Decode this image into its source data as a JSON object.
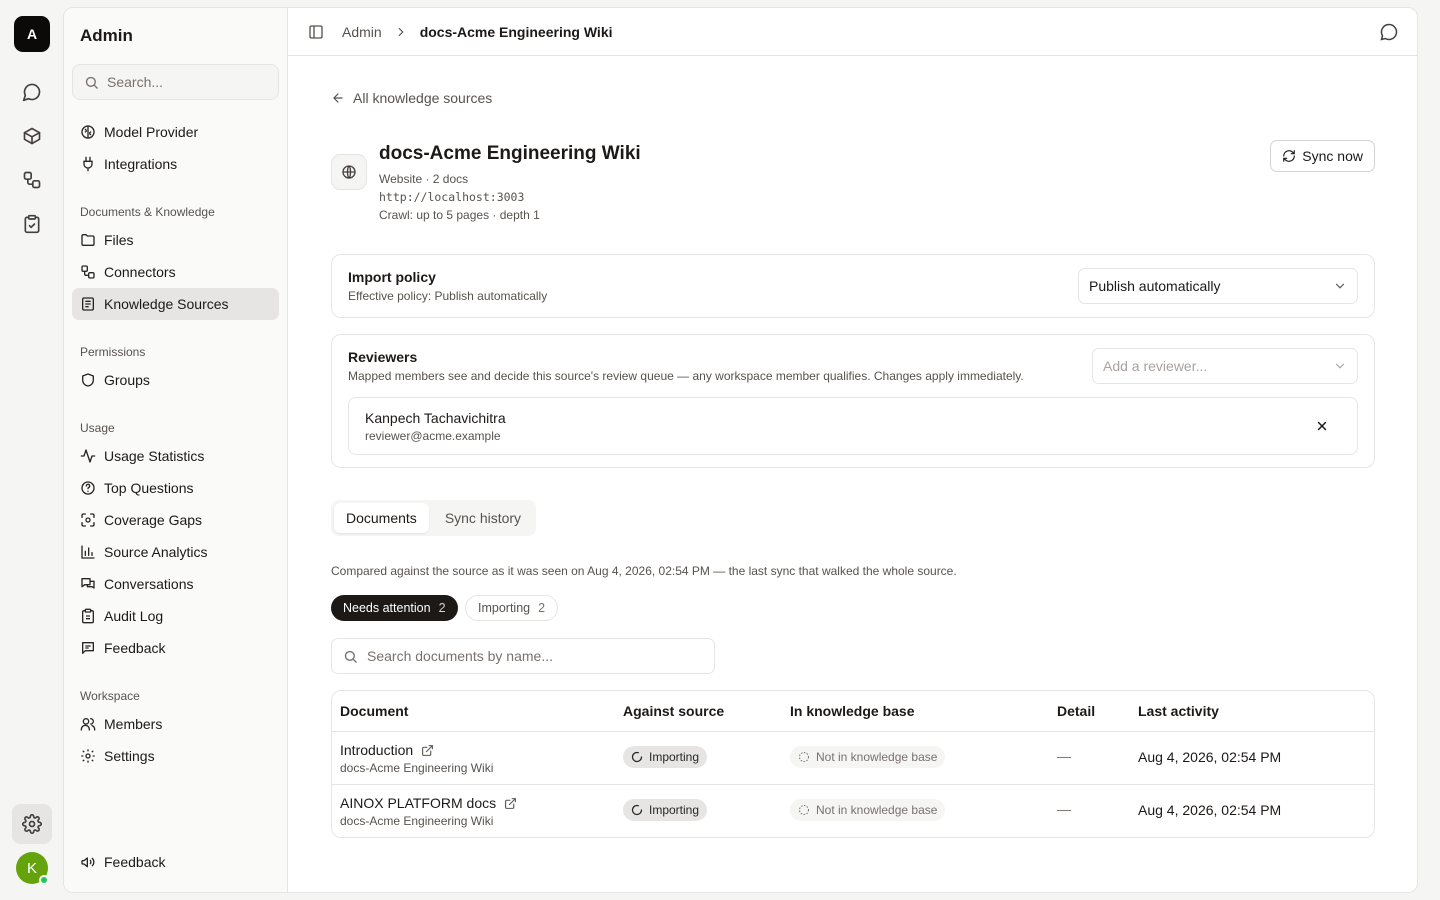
{
  "rail": {
    "logo_letter": "A",
    "avatar_letter": "K",
    "items": [
      "chat-icon",
      "box-icon",
      "workflow-icon",
      "clipboard-check-icon"
    ],
    "active_item": "settings-icon"
  },
  "sidebar": {
    "title": "Admin",
    "search_placeholder": "Search...",
    "top_items": [
      {
        "label": "Model Provider",
        "icon": "brain-icon"
      },
      {
        "label": "Integrations",
        "icon": "plug-icon"
      }
    ],
    "sections": [
      {
        "title": "Documents & Knowledge",
        "items": [
          {
            "label": "Files",
            "icon": "folder-icon"
          },
          {
            "label": "Connectors",
            "icon": "connector-icon"
          },
          {
            "label": "Knowledge Sources",
            "icon": "book-icon",
            "active": true
          }
        ]
      },
      {
        "title": "Permissions",
        "items": [
          {
            "label": "Groups",
            "icon": "shield-icon"
          }
        ]
      },
      {
        "title": "Usage",
        "items": [
          {
            "label": "Usage Statistics",
            "icon": "activity-icon"
          },
          {
            "label": "Top Questions",
            "icon": "help-circle-icon"
          },
          {
            "label": "Coverage Gaps",
            "icon": "scan-icon"
          },
          {
            "label": "Source Analytics",
            "icon": "bar-chart-icon"
          },
          {
            "label": "Conversations",
            "icon": "messages-icon"
          },
          {
            "label": "Audit Log",
            "icon": "clipboard-icon"
          },
          {
            "label": "Feedback",
            "icon": "message-square-icon"
          }
        ]
      },
      {
        "title": "Workspace",
        "items": [
          {
            "label": "Members",
            "icon": "users-icon"
          },
          {
            "label": "Settings",
            "icon": "gear-icon"
          }
        ]
      }
    ],
    "footer_item": {
      "label": "Feedback",
      "icon": "megaphone-icon"
    }
  },
  "header": {
    "breadcrumb_root": "Admin",
    "breadcrumb_current": "docs-Acme Engineering Wiki"
  },
  "source": {
    "back_label": "All knowledge sources",
    "title": "docs-Acme Engineering Wiki",
    "type_line": "Website · 2 docs",
    "url": "http://localhost:3003",
    "crawl_line": "Crawl: up to 5 pages · depth 1",
    "sync_label": "Sync now"
  },
  "import_policy": {
    "title": "Import policy",
    "subtitle": "Effective policy: Publish automatically",
    "selected": "Publish automatically"
  },
  "reviewers": {
    "title": "Reviewers",
    "subtitle": "Mapped members see and decide this source's review queue — any workspace member qualifies. Changes apply immediately.",
    "add_placeholder": "Add a reviewer...",
    "list": [
      {
        "name": "Kanpech Tachavichitra",
        "email": "reviewer@acme.example"
      }
    ]
  },
  "tabs": [
    "Documents",
    "Sync history"
  ],
  "compared_note": "Compared against the source as it was seen on Aug 4, 2026, 02:54 PM — the last sync that walked the whole source.",
  "filters": [
    {
      "label": "Needs attention",
      "count": "2",
      "active": true
    },
    {
      "label": "Importing",
      "count": "2",
      "active": false
    }
  ],
  "doc_search_placeholder": "Search documents by name...",
  "table": {
    "columns": [
      "Document",
      "Against source",
      "In knowledge base",
      "Detail",
      "Last activity"
    ],
    "rows": [
      {
        "name": "Introduction",
        "source": "docs-Acme Engineering Wiki",
        "against": "Importing",
        "in_kb": "Not in knowledge base",
        "detail": "—",
        "last": "Aug 4, 2026, 02:54 PM"
      },
      {
        "name": "AINOX PLATFORM docs",
        "source": "docs-Acme Engineering Wiki",
        "against": "Importing",
        "in_kb": "Not in knowledge base",
        "detail": "—",
        "last": "Aug 4, 2026, 02:54 PM"
      }
    ]
  }
}
